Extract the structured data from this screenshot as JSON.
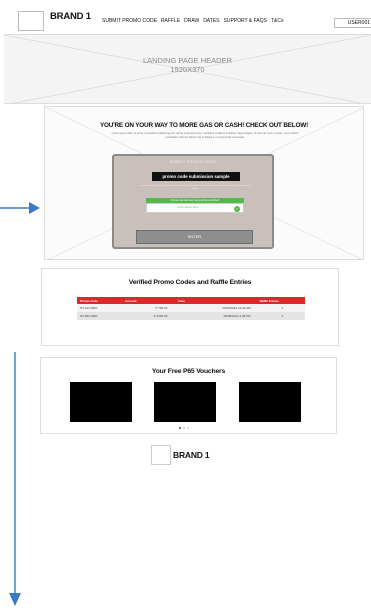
{
  "nav": {
    "brand": "BRAND 1",
    "links": [
      "SUBMIT PROMO CODE",
      "RAFFLE",
      "DRAW",
      "DATES",
      "SUPPORT & FAQS",
      "T&Cs"
    ],
    "user": "USER001"
  },
  "landing": {
    "title_line1": "LANDING PAGE HEADER",
    "title_line2": "1920X370"
  },
  "promo": {
    "heading": "YOU'RE ON YOUR WAY TO MORE GAS OR CASH! CHECK OUT BELOW!",
    "subtext": "Lorem ipsum dolor sit amet, consectetur adipiscing elit, sed do eiusmod tempor incididunt ut labore et dolore magna aliqua. Ut enim ad minim veniam, quis nostrud exercitation ullamco laboris nisi ut aliquip ex ea commodo consequat.",
    "card": {
      "title": "SUBMIT PROMO CODE",
      "input_value": "promo code submission sample",
      "note": "Lorem ipsum dolor sit amet consectetur adipiscing elit sed do eiusmod tempor incididunt ut labore et dolore magna aliqua.",
      "success_text": "Promo code has been successfully submitted!",
      "confirm_text": "Lorem ipsum dolor",
      "enter_label": "ENTER"
    }
  },
  "verified": {
    "heading": "Verified Promo Codes and Raffle   Entries",
    "columns": [
      "Promo Code",
      "Amount",
      "Date",
      "Raffle Entries"
    ],
    "rows": [
      [
        "NT-123-4567",
        "P 700.00",
        "10/25/2022 10:46 AM",
        "1"
      ],
      [
        "NT-563-4487",
        "P 1006.00",
        "08/08/2022 2:48 PM",
        "2"
      ]
    ]
  },
  "vouchers": {
    "heading": "Your Free P65 Vouchers",
    "count": 3,
    "active_dot": 0
  },
  "footer": {
    "brand": "BRAND 1"
  },
  "colors": {
    "table_header": "#d52b2b",
    "success": "#53b94a",
    "arrow": "#3a78c8",
    "card_bg": "#c9bfbb"
  }
}
